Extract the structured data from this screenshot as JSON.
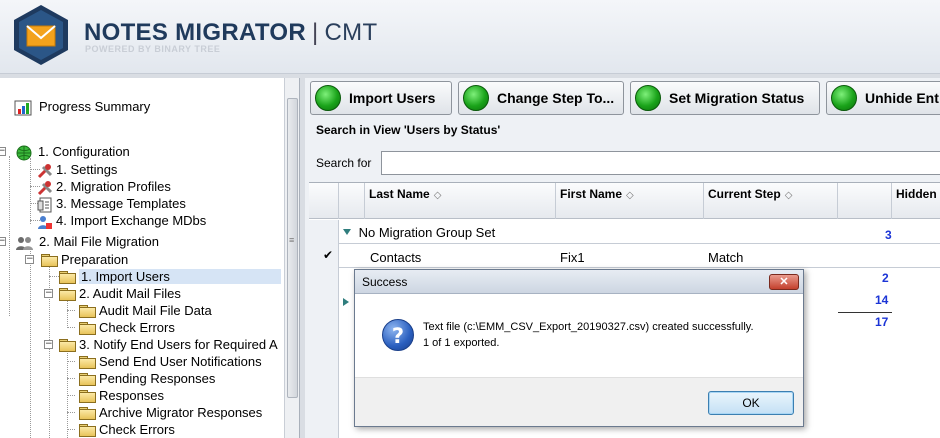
{
  "header": {
    "brand": "NOTES MIGRATOR",
    "separator": "|",
    "product": "CMT",
    "powered_by": "POWERED BY BINARY TREE"
  },
  "tree": {
    "progress_summary": "Progress Summary",
    "configuration": "1. Configuration",
    "settings": "1. Settings",
    "migration_profiles": "2. Migration Profiles",
    "message_templates": "3. Message Templates",
    "import_exchange_mdbs": "4. Import Exchange MDbs",
    "mail_file_migration": "2. Mail File Migration",
    "preparation": "Preparation",
    "import_users": "1. Import Users",
    "audit_mail_files": "2. Audit Mail Files",
    "audit_mail_file_data": "Audit Mail File Data",
    "check_errors_1": "Check Errors",
    "notify_end_users": "3. Notify End Users for Required A",
    "send_end_user_notifications": "Send End User Notifications",
    "pending_responses": "Pending Responses",
    "responses": "Responses",
    "archive_migrator_responses": "Archive Migrator Responses",
    "check_errors_2": "Check Errors"
  },
  "toolbar": {
    "import_users": "Import Users",
    "change_step_to": "Change Step To...",
    "set_migration_status": "Set Migration Status",
    "unhide_ent": "Unhide Ent"
  },
  "search": {
    "view_label": "Search in View 'Users by Status'",
    "search_for": "Search for",
    "value": ""
  },
  "grid": {
    "columns": {
      "last_name": "Last Name",
      "first_name": "First Name",
      "current_step": "Current Step",
      "hidden": "Hidden"
    },
    "sort_glyph": "◇",
    "group_label": "No Migration Group Set",
    "group_count": "3",
    "row_check": "✔",
    "row": {
      "last_name": "Contacts",
      "first_name": "Fix1",
      "current_step": "Match"
    },
    "counts": [
      "2",
      "14",
      "17"
    ]
  },
  "dialog": {
    "title": "Success",
    "close_glyph": "✕",
    "message_line1": "Text file (c:\\EMM_CSV_Export_20190327.csv) created successfully.",
    "message_line2": "1 of 1 exported.",
    "ok_label": "OK"
  },
  "colors": {
    "accent_green": "#1aa31a",
    "count_blue": "#1b34d6"
  }
}
